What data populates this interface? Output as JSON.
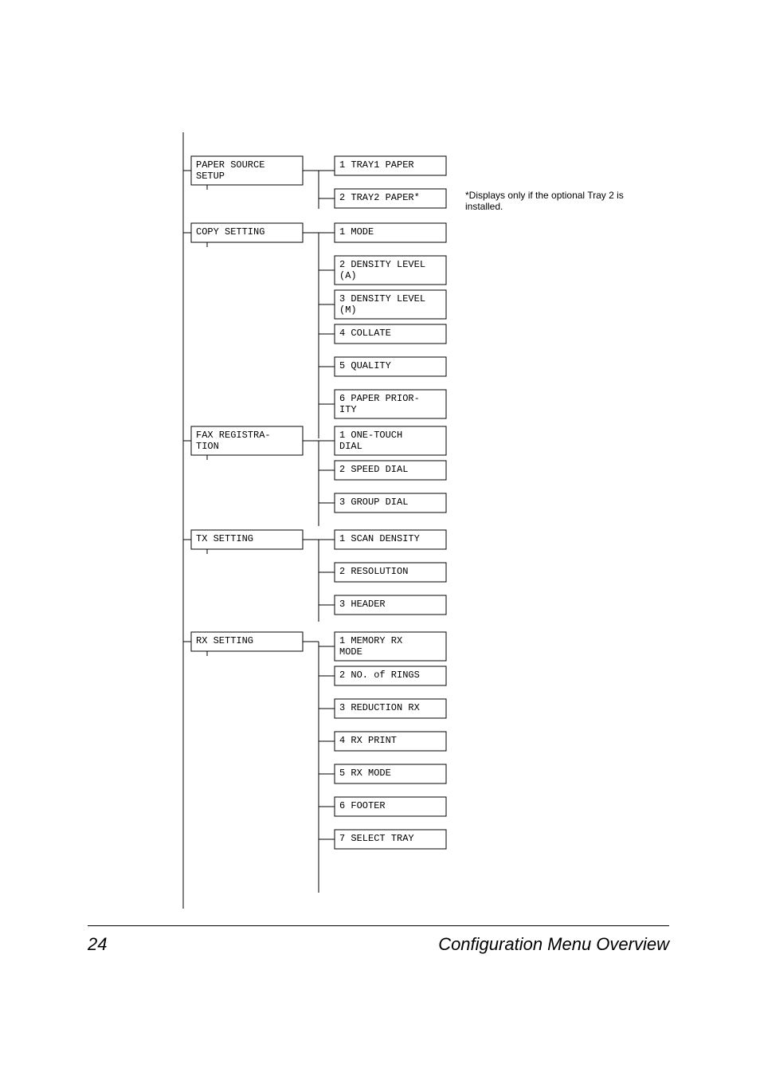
{
  "col1": {
    "paper_source": "PAPER SOURCE\nSETUP",
    "copy_setting": "COPY SETTING",
    "fax_registration": "FAX REGISTRA-\nTION",
    "tx_setting": "TX SETTING",
    "rx_setting": "RX SETTING"
  },
  "col2": {
    "tray1": "1 TRAY1 PAPER",
    "tray2": "2 TRAY2 PAPER*",
    "mode": "1 MODE",
    "density_a": "2 DENSITY LEVEL\n(A)",
    "density_m": "3 DENSITY LEVEL\n(M)",
    "collate": "4 COLLATE",
    "quality": "5 QUALITY",
    "paper_priority": "6 PAPER PRIOR-\nITY",
    "one_touch": "1 ONE-TOUCH\nDIAL",
    "speed_dial": "2 SPEED DIAL",
    "group_dial": "3 GROUP DIAL",
    "scan_density": "1 SCAN DENSITY",
    "resolution": "2 RESOLUTION",
    "header": "3 HEADER",
    "memory_rx": "1 MEMORY RX\nMODE",
    "no_of_rings": "2 NO. of RINGS",
    "reduction_rx": "3 REDUCTION RX",
    "rx_print": "4 RX PRINT",
    "rx_mode": "5 RX MODE",
    "footer": "6 FOOTER",
    "select_tray": "7 SELECT TRAY"
  },
  "note": "*Displays only if the optional\nTray 2 is installed.",
  "footer": {
    "page_number": "24",
    "title": "Configuration Menu Overview"
  }
}
